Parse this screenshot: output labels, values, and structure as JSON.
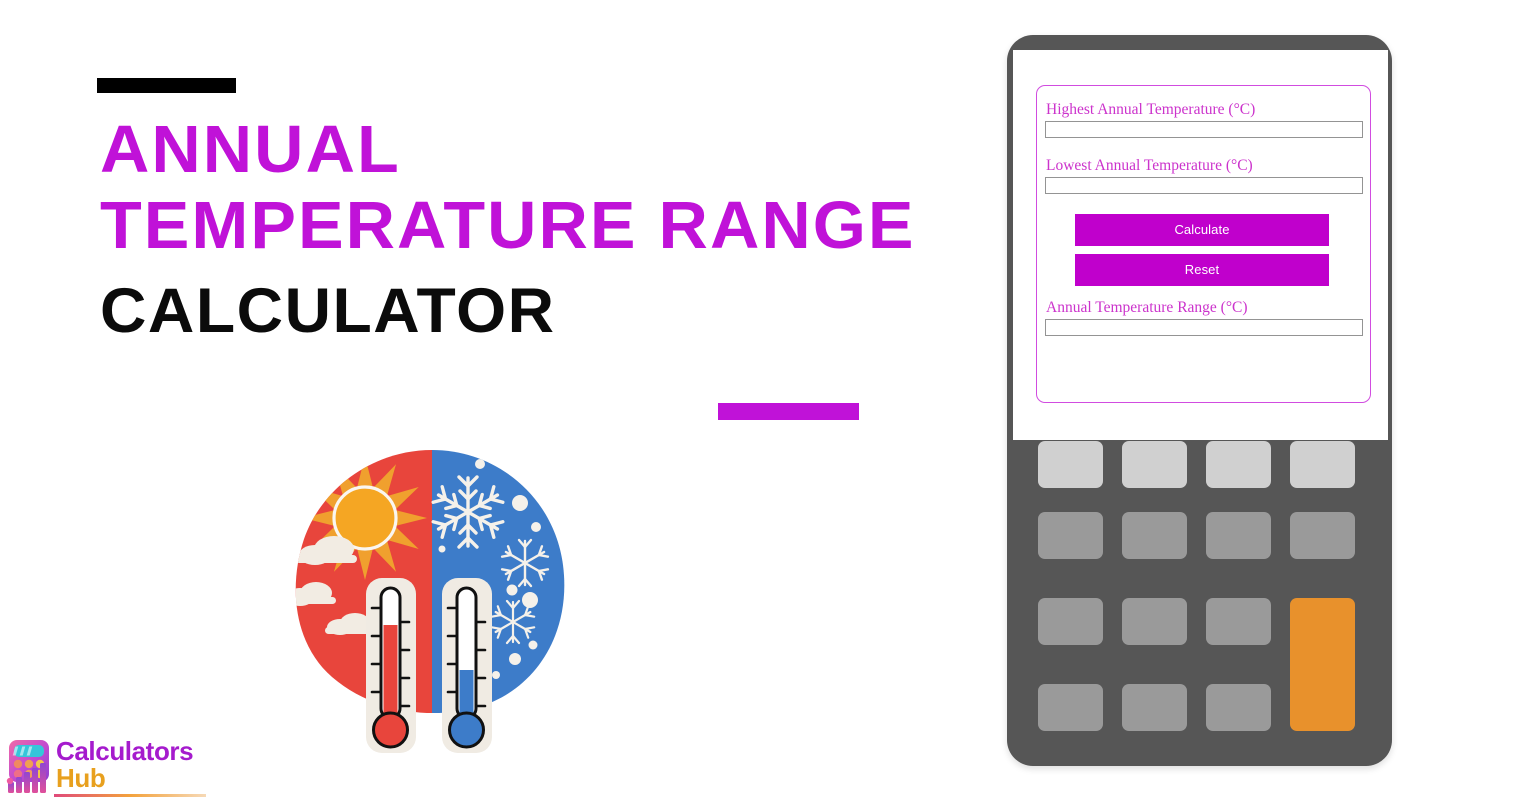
{
  "page": {
    "background_color": "#ffffff",
    "accent_purple": "#c012d8",
    "accent_black": "#0b0b0b"
  },
  "hero": {
    "rule_top": {
      "name": "top-rule",
      "color": "#000000"
    },
    "rule_bottom": {
      "name": "bottom-rule",
      "color": "#c012d8"
    },
    "title_lines": [
      {
        "text": "ANNUAL",
        "color": "#c012d8"
      },
      {
        "text": "TEMPERATURE RANGE",
        "color": "#c012d8"
      },
      {
        "text": "CALCULATOR",
        "color": "#0b0b0b"
      }
    ]
  },
  "illustration": {
    "name": "hot-cold-thermometers-illustration",
    "hot_color": "#e8453c",
    "cold_color": "#3d7cc9",
    "sun_color": "#f5a623",
    "sun_ray_color": "#f0a02e",
    "cloud_color": "#f2ece3",
    "snowflake_color": "#f5f1ea",
    "thermometer_plate_color": "#f0ebe3",
    "thermometer_hot_fill": "#e8453c",
    "thermometer_cold_fill": "#3d7cc9",
    "hot_level_percent": 82,
    "cold_level_percent": 38
  },
  "logo": {
    "name": "calculators-hub-logo",
    "word_1": "Calculators",
    "word_2": "Hub",
    "word_1_color": "#a51bcd",
    "word_2_color": "#e8a01e",
    "icon_name": "calculator-bar-chart-icon"
  },
  "calculator": {
    "body_color": "#565656",
    "screen_color": "#ffffff",
    "card_border_color": "#d14ce0",
    "form": {
      "fields": [
        {
          "id": "highest-annual-temperature",
          "label": "Highest Annual Temperature (°C)",
          "value": "",
          "placeholder": ""
        },
        {
          "id": "lowest-annual-temperature",
          "label": "Lowest Annual Temperature (°C)",
          "value": "",
          "placeholder": ""
        }
      ],
      "result": {
        "id": "annual-temperature-range",
        "label": "Annual Temperature Range (°C)",
        "value": "",
        "placeholder": ""
      },
      "buttons": [
        {
          "id": "calculate",
          "label": "Calculate",
          "color": "#c000cc",
          "text_color": "#ffffff"
        },
        {
          "id": "reset",
          "label": "Reset",
          "color": "#c000cc",
          "text_color": "#ffffff"
        }
      ]
    },
    "keypad": {
      "rows": 4,
      "cols": 4,
      "key_light_color": "#d0d0d0",
      "key_mid_color": "#9a9a9a",
      "key_accent_color": "#e8912c"
    }
  }
}
